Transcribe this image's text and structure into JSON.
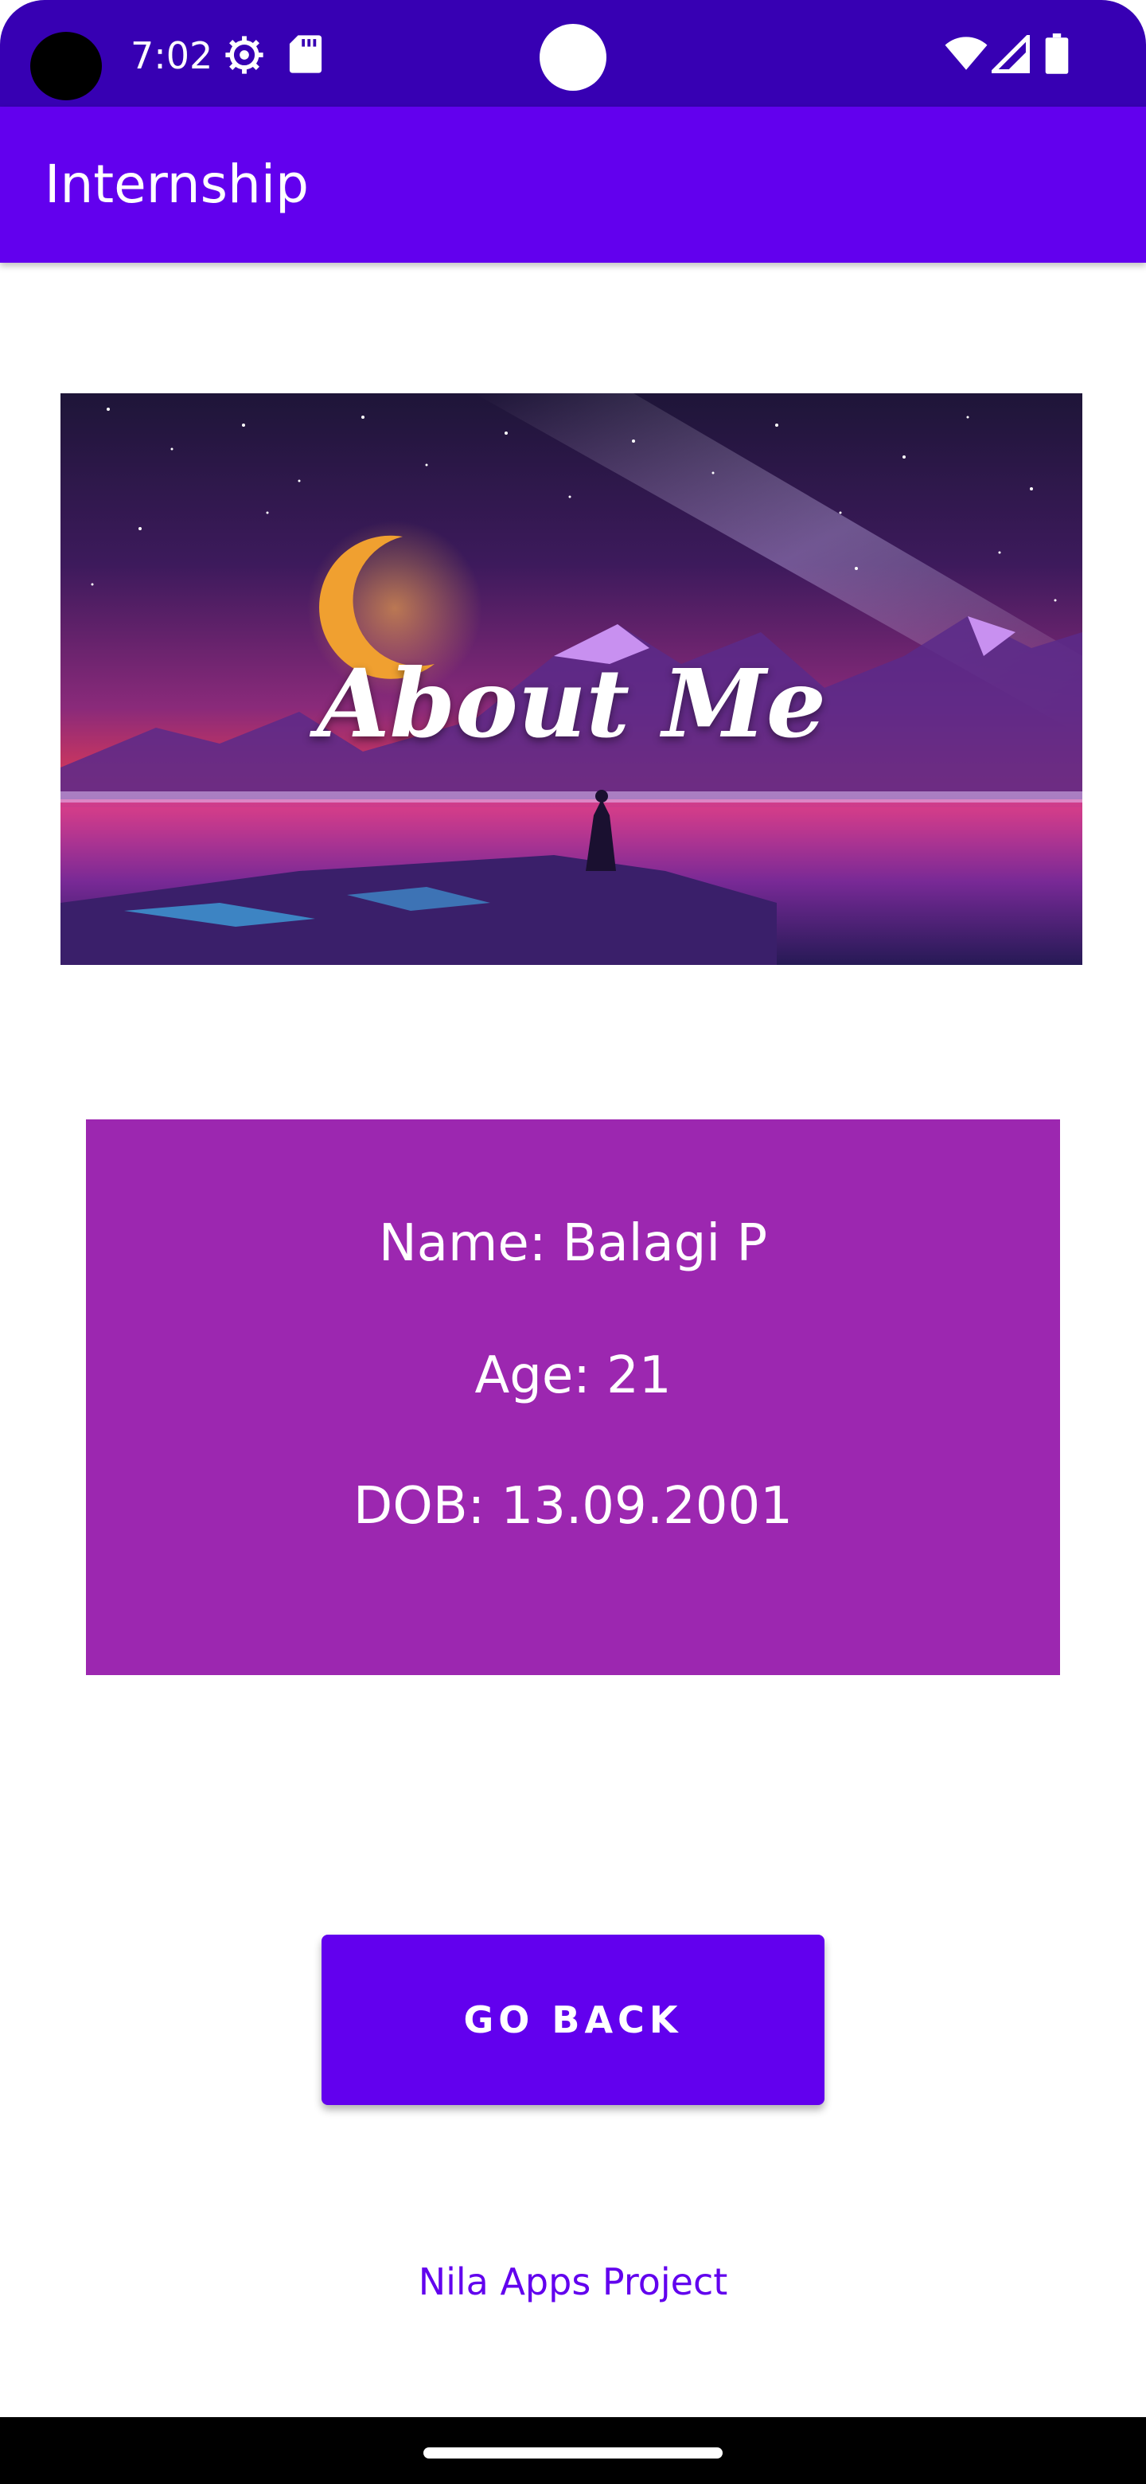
{
  "status_bar": {
    "time": "7:02",
    "icons": [
      "settings-gear-icon",
      "sd-card-icon",
      "wifi-icon",
      "signal-icon",
      "battery-icon"
    ],
    "color": "#3700b3"
  },
  "app_bar": {
    "title": "Internship",
    "color": "#6200ee"
  },
  "banner": {
    "title": "About Me"
  },
  "info_card": {
    "name": "Name: Balagi P",
    "age": "Age: 21",
    "dob": "DOB: 13.09.2001",
    "color": "#9c27b0"
  },
  "actions": {
    "go_back_label": "GO BACK",
    "accent": "#6200ee"
  },
  "footer": {
    "link_text": "Nila Apps Project"
  }
}
